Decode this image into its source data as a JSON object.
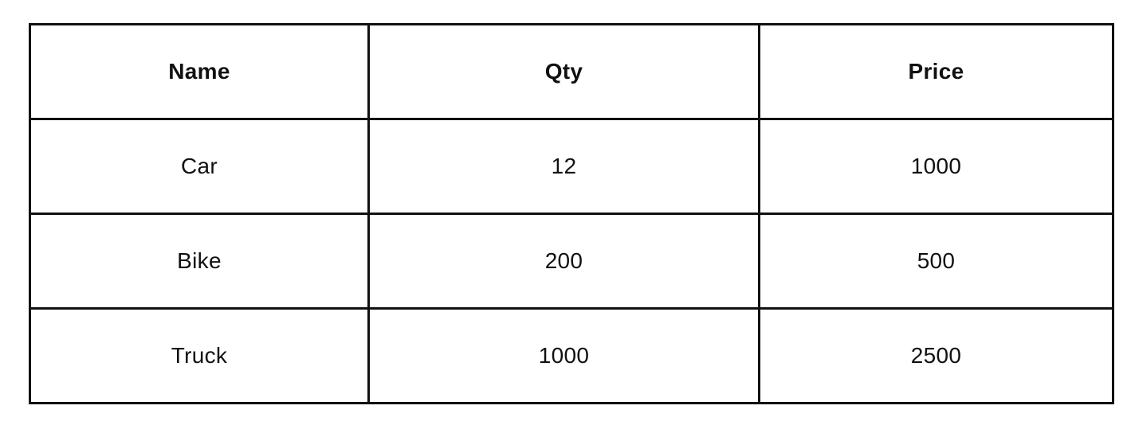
{
  "table": {
    "columns": [
      "Name",
      "Qty",
      "Price"
    ],
    "rows": [
      [
        "Car",
        "12",
        "1000"
      ],
      [
        "Bike",
        "200",
        "500"
      ],
      [
        "Truck",
        "1000",
        "2500"
      ]
    ],
    "border_color": "#111111",
    "background_color": "#ffffff"
  }
}
